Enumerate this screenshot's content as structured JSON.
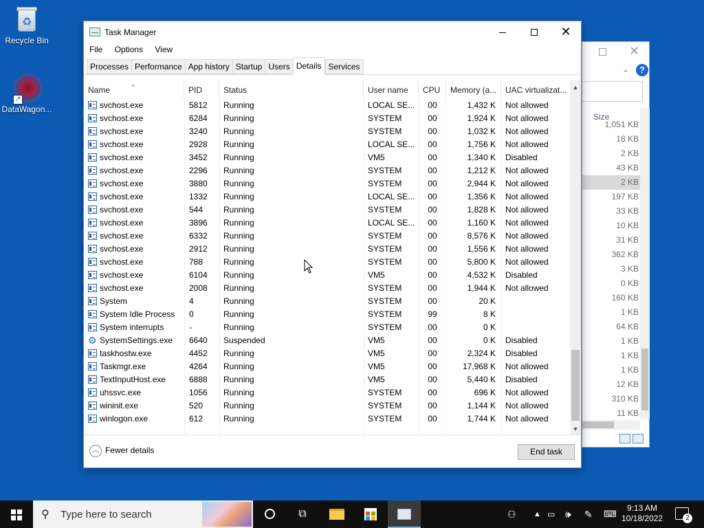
{
  "desktop": {
    "icons": [
      {
        "label": "Recycle Bin"
      },
      {
        "label": "DataWagon..."
      }
    ]
  },
  "background_window": {
    "column_header": "Size",
    "sizes": [
      "1,051 KB",
      "18 KB",
      "2 KB",
      "43 KB",
      "2 KB",
      "197 KB",
      "33 KB",
      "10 KB",
      "31 KB",
      "362 KB",
      "3 KB",
      "0 KB",
      "160 KB",
      "1 KB",
      "64 KB",
      "1 KB",
      "1 KB",
      "1 KB",
      "12 KB",
      "310 KB",
      "11 KB"
    ],
    "help_glyph": "?"
  },
  "taskmanager": {
    "title": "Task Manager",
    "menu": [
      "File",
      "Options",
      "View"
    ],
    "tabs": [
      "Processes",
      "Performance",
      "App history",
      "Startup",
      "Users",
      "Details",
      "Services"
    ],
    "active_tab": "Details",
    "columns": [
      "Name",
      "PID",
      "Status",
      "User name",
      "CPU",
      "Memory (a...",
      "UAC virtualizat..."
    ],
    "rows": [
      {
        "name": "svchost.exe",
        "pid": "5812",
        "status": "Running",
        "user": "LOCAL SE...",
        "cpu": "00",
        "mem": "1,432 K",
        "uac": "Not allowed",
        "icon": "process-icon"
      },
      {
        "name": "svchost.exe",
        "pid": "6284",
        "status": "Running",
        "user": "SYSTEM",
        "cpu": "00",
        "mem": "1,924 K",
        "uac": "Not allowed",
        "icon": "process-icon"
      },
      {
        "name": "svchost.exe",
        "pid": "3240",
        "status": "Running",
        "user": "SYSTEM",
        "cpu": "00",
        "mem": "1,032 K",
        "uac": "Not allowed",
        "icon": "process-icon"
      },
      {
        "name": "svchost.exe",
        "pid": "2928",
        "status": "Running",
        "user": "LOCAL SE...",
        "cpu": "00",
        "mem": "1,756 K",
        "uac": "Not allowed",
        "icon": "process-icon"
      },
      {
        "name": "svchost.exe",
        "pid": "3452",
        "status": "Running",
        "user": "VM5",
        "cpu": "00",
        "mem": "1,340 K",
        "uac": "Disabled",
        "icon": "process-icon"
      },
      {
        "name": "svchost.exe",
        "pid": "2296",
        "status": "Running",
        "user": "SYSTEM",
        "cpu": "00",
        "mem": "1,212 K",
        "uac": "Not allowed",
        "icon": "process-icon"
      },
      {
        "name": "svchost.exe",
        "pid": "3880",
        "status": "Running",
        "user": "SYSTEM",
        "cpu": "00",
        "mem": "2,944 K",
        "uac": "Not allowed",
        "icon": "process-icon"
      },
      {
        "name": "svchost.exe",
        "pid": "1332",
        "status": "Running",
        "user": "LOCAL SE...",
        "cpu": "00",
        "mem": "1,356 K",
        "uac": "Not allowed",
        "icon": "process-icon"
      },
      {
        "name": "svchost.exe",
        "pid": "544",
        "status": "Running",
        "user": "SYSTEM",
        "cpu": "00",
        "mem": "1,828 K",
        "uac": "Not allowed",
        "icon": "process-icon"
      },
      {
        "name": "svchost.exe",
        "pid": "3896",
        "status": "Running",
        "user": "LOCAL SE...",
        "cpu": "00",
        "mem": "1,160 K",
        "uac": "Not allowed",
        "icon": "process-icon"
      },
      {
        "name": "svchost.exe",
        "pid": "6332",
        "status": "Running",
        "user": "SYSTEM",
        "cpu": "00",
        "mem": "8,576 K",
        "uac": "Not allowed",
        "icon": "process-icon"
      },
      {
        "name": "svchost.exe",
        "pid": "2912",
        "status": "Running",
        "user": "SYSTEM",
        "cpu": "00",
        "mem": "1,556 K",
        "uac": "Not allowed",
        "icon": "process-icon"
      },
      {
        "name": "svchost.exe",
        "pid": "788",
        "status": "Running",
        "user": "SYSTEM",
        "cpu": "00",
        "mem": "5,800 K",
        "uac": "Not allowed",
        "icon": "process-icon"
      },
      {
        "name": "svchost.exe",
        "pid": "6104",
        "status": "Running",
        "user": "VM5",
        "cpu": "00",
        "mem": "4,532 K",
        "uac": "Disabled",
        "icon": "process-icon"
      },
      {
        "name": "svchost.exe",
        "pid": "2008",
        "status": "Running",
        "user": "SYSTEM",
        "cpu": "00",
        "mem": "1,944 K",
        "uac": "Not allowed",
        "icon": "process-icon"
      },
      {
        "name": "System",
        "pid": "4",
        "status": "Running",
        "user": "SYSTEM",
        "cpu": "00",
        "mem": "20 K",
        "uac": "",
        "icon": "process-icon"
      },
      {
        "name": "System Idle Process",
        "pid": "0",
        "status": "Running",
        "user": "SYSTEM",
        "cpu": "99",
        "mem": "8 K",
        "uac": "",
        "icon": "process-icon"
      },
      {
        "name": "System interrupts",
        "pid": "-",
        "status": "Running",
        "user": "SYSTEM",
        "cpu": "00",
        "mem": "0 K",
        "uac": "",
        "icon": "process-icon"
      },
      {
        "name": "SystemSettings.exe",
        "pid": "6640",
        "status": "Suspended",
        "user": "VM5",
        "cpu": "00",
        "mem": "0 K",
        "uac": "Disabled",
        "icon": "settings-gear-icon"
      },
      {
        "name": "taskhostw.exe",
        "pid": "4452",
        "status": "Running",
        "user": "VM5",
        "cpu": "00",
        "mem": "2,324 K",
        "uac": "Disabled",
        "icon": "process-icon"
      },
      {
        "name": "Taskmgr.exe",
        "pid": "4264",
        "status": "Running",
        "user": "VM5",
        "cpu": "00",
        "mem": "17,968 K",
        "uac": "Not allowed",
        "icon": "task-manager-icon"
      },
      {
        "name": "TextInputHost.exe",
        "pid": "6888",
        "status": "Running",
        "user": "VM5",
        "cpu": "00",
        "mem": "5,440 K",
        "uac": "Disabled",
        "icon": "process-icon"
      },
      {
        "name": "uhssvc.exe",
        "pid": "1056",
        "status": "Running",
        "user": "SYSTEM",
        "cpu": "00",
        "mem": "696 K",
        "uac": "Not allowed",
        "icon": "process-icon"
      },
      {
        "name": "wininit.exe",
        "pid": "520",
        "status": "Running",
        "user": "SYSTEM",
        "cpu": "00",
        "mem": "1,144 K",
        "uac": "Not allowed",
        "icon": "process-icon"
      },
      {
        "name": "winlogon.exe",
        "pid": "612",
        "status": "Running",
        "user": "SYSTEM",
        "cpu": "00",
        "mem": "1,744 K",
        "uac": "Not allowed",
        "icon": "process-icon"
      }
    ],
    "fewer_details": "Fewer details",
    "end_task": "End task"
  },
  "taskbar": {
    "search_placeholder": "Type here to search",
    "time": "9:13 AM",
    "date": "10/18/2022",
    "notification_count": "2"
  },
  "colors": {
    "desktop_bg": "#0b5bb5",
    "taskbar_bg": "#101010",
    "accent": "#76b9ed"
  }
}
